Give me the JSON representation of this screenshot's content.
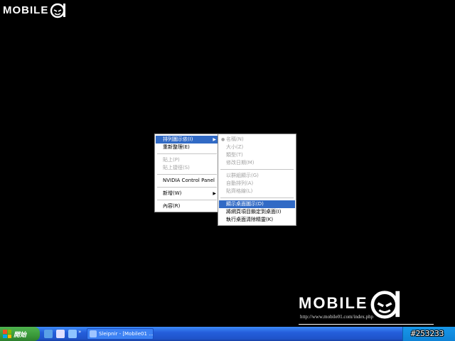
{
  "watermark": {
    "brand_text": "MOBILE",
    "brand_suffix": "01",
    "url": "http://www.mobile01.com/index.php",
    "image_id": "#253233"
  },
  "context_menu": {
    "items": [
      {
        "label": "排列圖示依(I)",
        "state": "highlight",
        "submenu": true
      },
      {
        "label": "重新整理(E)",
        "state": "normal"
      },
      {
        "label": "貼上(P)",
        "state": "disabled"
      },
      {
        "label": "貼上捷徑(S)",
        "state": "disabled"
      },
      {
        "label": "NVIDIA Control Panel",
        "state": "normal"
      },
      {
        "label": "新增(W)",
        "state": "normal",
        "submenu": true
      },
      {
        "label": "內容(R)",
        "state": "normal"
      }
    ]
  },
  "submenu": {
    "items": [
      {
        "label": "名稱(N)",
        "state": "disabled",
        "bullet": true
      },
      {
        "label": "大小(Z)",
        "state": "disabled"
      },
      {
        "label": "類型(T)",
        "state": "disabled"
      },
      {
        "label": "修改日期(M)",
        "state": "disabled"
      },
      {
        "label": "以群組顯示(G)",
        "state": "disabled"
      },
      {
        "label": "自動排列(A)",
        "state": "disabled"
      },
      {
        "label": "貼齊格線(L)",
        "state": "disabled"
      },
      {
        "label": "顯示桌面圖示(D)",
        "state": "highlight"
      },
      {
        "label": "將網頁項目鎖定到桌面(I)",
        "state": "normal"
      },
      {
        "label": "執行桌面清除精靈(K)",
        "state": "normal"
      }
    ]
  },
  "taskbar": {
    "start_label": "開始",
    "task_label": "Sleipnir - [Mobile01 ..."
  },
  "colors": {
    "highlight": "#316ac5",
    "taskbar": "#245edb",
    "start": "#3a9a3a"
  }
}
